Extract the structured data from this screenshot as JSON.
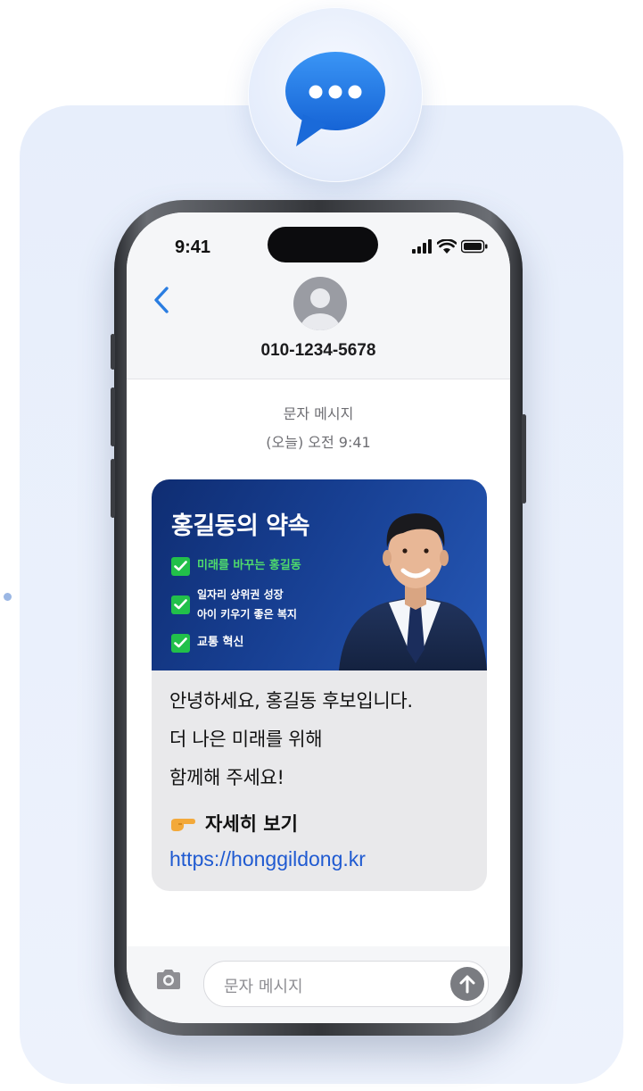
{
  "status_bar": {
    "time": "9:41"
  },
  "contact": {
    "number": "010-1234-5678"
  },
  "thread": {
    "type_label": "문자 메시지",
    "timestamp": "(오늘) 오전 9:41"
  },
  "message": {
    "banner": {
      "title": "홍길동의 약속",
      "pledges": [
        "미래를 바꾸는 홍길동",
        "일자리 상위권 성장",
        "아이 키우기 좋은 복지",
        "교통 혁신"
      ]
    },
    "body": [
      "안녕하세요, 홍길동 후보입니다.",
      "더 나은 미래를 위해",
      "함께해 주세요!"
    ],
    "cta": "자세히 보기",
    "link": "https://honggildong.kr"
  },
  "composer": {
    "placeholder": "문자 메시지"
  },
  "colors": {
    "accent_blue": "#1f5ad1",
    "banner_blue": "#173f92",
    "check_green": "#22c04a",
    "bubble_gray": "#e9e9eb",
    "badge_blue": "#2a7de1"
  },
  "icons": [
    "chat-bubble-icon",
    "back-chevron-icon",
    "contact-avatar-icon",
    "signal-icon",
    "wifi-icon",
    "battery-icon",
    "check-icon",
    "pointing-hand-icon",
    "camera-icon",
    "send-arrow-icon"
  ]
}
